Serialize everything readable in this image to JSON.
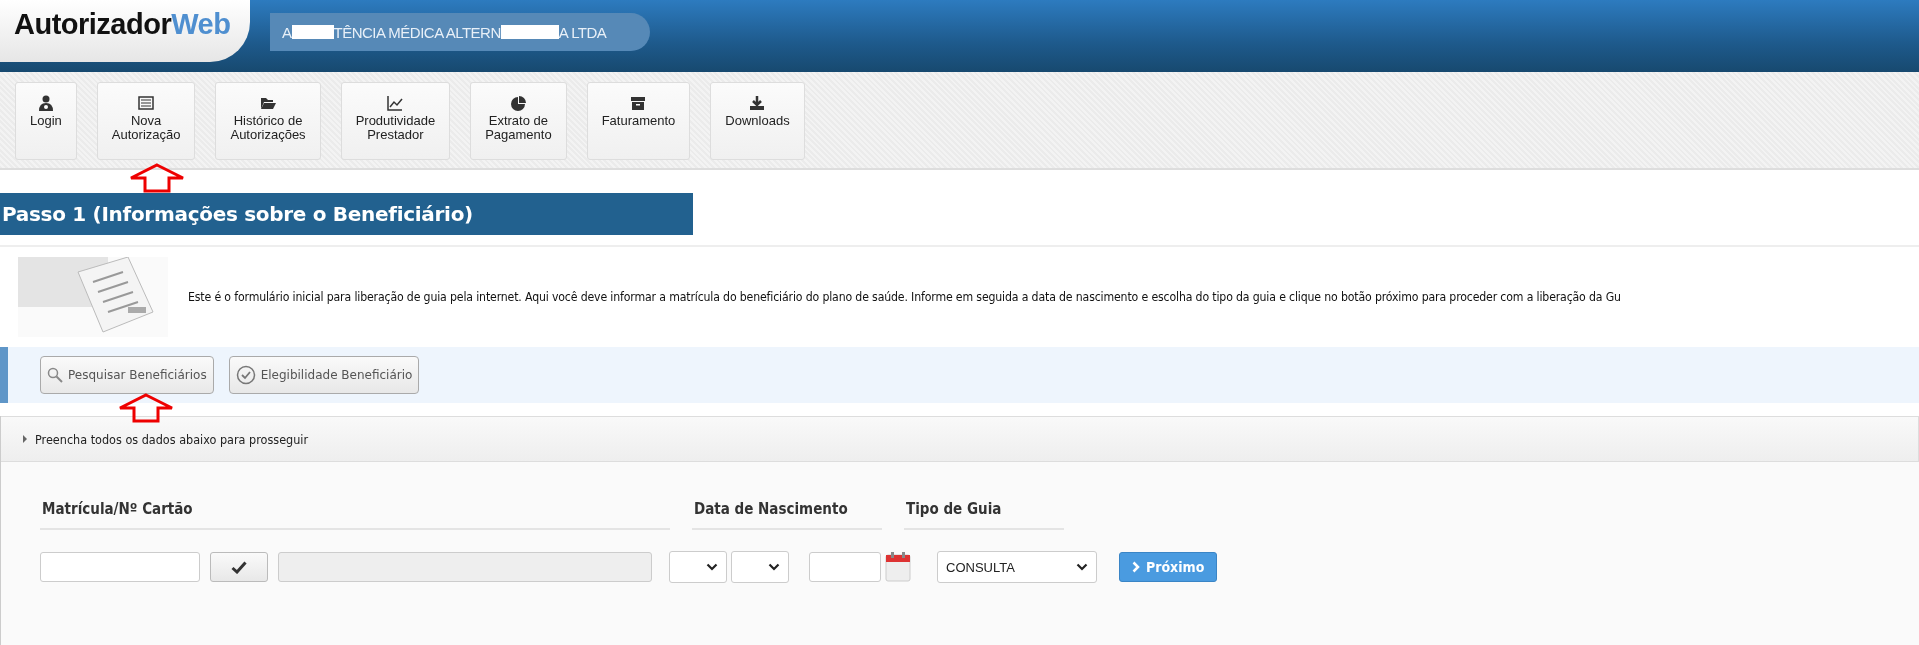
{
  "header": {
    "logo_parts": [
      "Autorizador",
      "Web"
    ],
    "company_parts": [
      "A",
      "TÊNCIA MÉDICA ALTERN",
      "A LTDA"
    ]
  },
  "toolbar": [
    {
      "kind": "user",
      "lines": [
        "Login"
      ]
    },
    {
      "kind": "list",
      "lines": [
        "Nova",
        "Autorização"
      ]
    },
    {
      "kind": "folder",
      "lines": [
        "Histórico de",
        "Autorizações"
      ]
    },
    {
      "kind": "chart",
      "lines": [
        "Produtividade",
        "Prestador"
      ]
    },
    {
      "kind": "pie",
      "lines": [
        "Extrato de",
        "Pagamento"
      ]
    },
    {
      "kind": "archive",
      "lines": [
        "Faturamento"
      ]
    },
    {
      "kind": "download",
      "lines": [
        "Downloads"
      ]
    }
  ],
  "step": {
    "title": "Passo 1 (Informações sobre o Beneficiário)",
    "description": "Este é o formulário inicial para liberação de guia pela internet. Aqui você deve informar a matrícula do beneficiário do plano de saúde. Informe em seguida a data de nascimento e escolha do tipo da guia e clique no botão próximo para proceder com a liberação da Gu"
  },
  "actions": [
    {
      "kind": "search",
      "label": "Pesquisar Beneficiários"
    },
    {
      "kind": "check",
      "label": "Elegibilidade Beneficiário"
    }
  ],
  "panel": {
    "title": "Preencha todos os dados abaixo para prosseguir",
    "expanded": false
  },
  "form": {
    "columns": [
      "Matrícula/Nº Cartão",
      "Data de Nascimento",
      "Tipo de Guia"
    ],
    "tipo_guia": "CONSULTA",
    "next_button": "Próximo"
  }
}
